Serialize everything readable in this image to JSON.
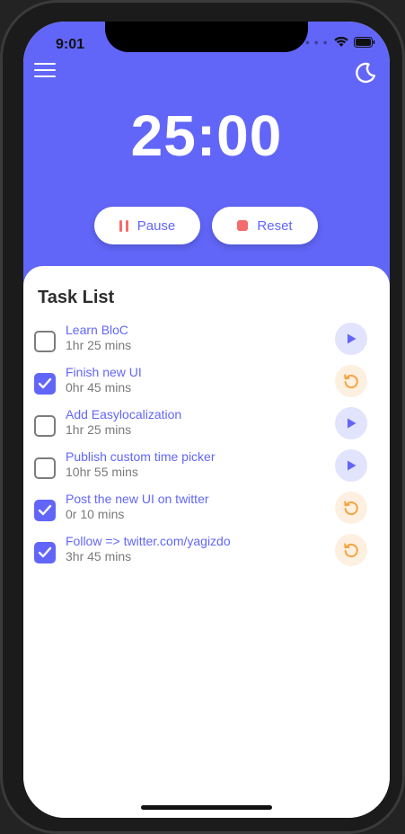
{
  "status_bar": {
    "time": "9:01"
  },
  "timer": {
    "display": "25:00"
  },
  "controls": {
    "pause_label": "Pause",
    "reset_label": "Reset"
  },
  "task_list": {
    "title": "Task List",
    "items": [
      {
        "name": "Learn BloC",
        "duration": "1hr 25 mins",
        "done": false,
        "action": "play"
      },
      {
        "name": "Finish new UI",
        "duration": "0hr 45 mins",
        "done": true,
        "action": "restart"
      },
      {
        "name": "Add Easylocalization",
        "duration": "1hr 25 mins",
        "done": false,
        "action": "play"
      },
      {
        "name": "Publish custom time picker",
        "duration": "10hr 55 mins",
        "done": false,
        "action": "play"
      },
      {
        "name": "Post the new UI on twitter",
        "duration": "0r 10 mins",
        "done": true,
        "action": "restart"
      },
      {
        "name": "Follow => twitter.com/yagizdo",
        "duration": "3hr 45 mins",
        "done": true,
        "action": "restart"
      }
    ]
  },
  "icons": {
    "menu": "hamburger-menu-icon",
    "theme": "moon-icon",
    "pause": "pause-icon",
    "reset": "stop-icon",
    "play": "play-icon",
    "restart": "restart-icon",
    "check": "checkmark-icon"
  },
  "colors": {
    "primary": "#6266f8",
    "accent_red": "#f46b6b",
    "play_bg": "#e2e3fd",
    "restart_bg": "#fdf0e0",
    "restart_icon": "#f5a443"
  }
}
